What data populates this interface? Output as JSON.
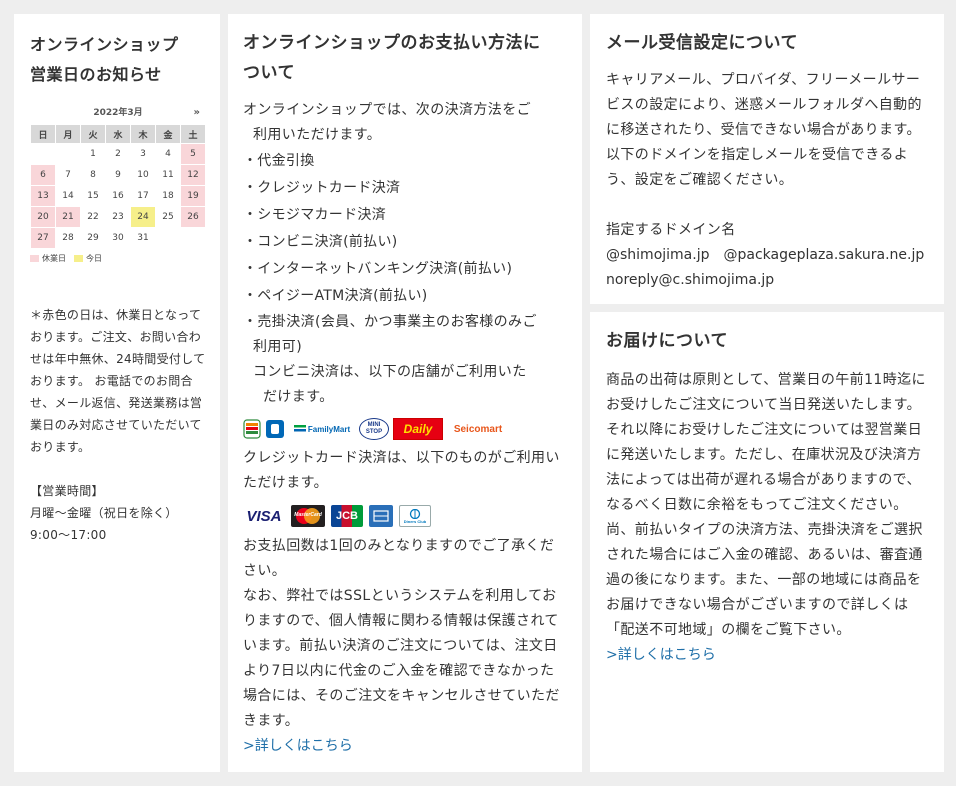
{
  "calendar_box": {
    "title_line1": "オンラインショップ",
    "title_line2": "営業日のお知らせ",
    "month": "2022年3月",
    "next": "»",
    "weekdays": [
      "日",
      "月",
      "火",
      "水",
      "木",
      "金",
      "土"
    ],
    "weeks": [
      [
        "",
        "",
        "1",
        "2",
        "3",
        "4",
        "5"
      ],
      [
        "6",
        "7",
        "8",
        "9",
        "10",
        "11",
        "12"
      ],
      [
        "13",
        "14",
        "15",
        "16",
        "17",
        "18",
        "19"
      ],
      [
        "20",
        "21",
        "22",
        "23",
        "24",
        "25",
        "26"
      ],
      [
        "27",
        "28",
        "29",
        "30",
        "31",
        "",
        ""
      ]
    ],
    "holidays": [
      "5",
      "6",
      "12",
      "13",
      "19",
      "20",
      "21",
      "26",
      "27"
    ],
    "today": "24",
    "legend_holiday": "休業日",
    "legend_today": "今日",
    "holiday_color": "#f9d6d9",
    "today_color": "#f6ef8a",
    "note": "＊赤色の日は、休業日となっております。ご注文、お問い合わせは年中無休、24時間受付しております。 お電話でのお問合せ、メール返信、発送業務は営業日のみ対応させていただいております。",
    "hours_heading": "【営業時間】",
    "hours_days": "月曜～金曜（祝日を除く）",
    "hours_time": "9:00～17:00"
  },
  "payment": {
    "title_line1": "オンラインショップのお支払い方法に",
    "title_line2": "ついて",
    "intro_line1": "オンラインショップでは、次の決済方法をご",
    "intro_line2": "利用いただけます。",
    "methods": [
      "・代金引換",
      "・クレジットカード決済",
      "・シモジマカード決済",
      "・コンビニ決済(前払い)",
      "・インターネットバンキング決済(前払い)",
      "・ペイジーATM決済(前払い)"
    ],
    "method_last_line1": "・売掛決済(会員、かつ事業主のお客様のみご",
    "method_last_line2": "利用可)",
    "conv_line1": "コンビニ決済は、以下の店舗がご利用いた",
    "conv_line2": "だけます。",
    "store_logos": [
      "seven-eleven-logo",
      "lawson-logo",
      "familymart-logo",
      "ministop-logo",
      "daily-yamazaki-logo",
      "seicomart-logo"
    ],
    "store_labels": {
      "familymart": "FamilyMart",
      "ministop": "MINI STOP",
      "daily": "Daily",
      "seicomart": "Seicomart"
    },
    "credit_text": "クレジットカード決済は、以下のものがご利用いただけます。",
    "card_labels": {
      "visa": "VISA",
      "mastercard": "MasterCard",
      "jcb": "JCB",
      "diners": "Diners Club"
    },
    "installments": "お支払回数は1回のみとなりますのでご了承ください。",
    "ssl_text": "なお、弊社ではSSLというシステムを利用しておりますので、個人情報に関わる情報は保護されています。前払い決済のご注文については、注文日より7日以内に代金のご入金を確認できなかった場合には、そのご注文をキャンセルさせていただきます。",
    "more_link": ">詳しくはこちら"
  },
  "mail": {
    "title": "メール受信設定について",
    "body": "キャリアメール、プロバイダ、フリーメールサービスの設定により、迷惑メールフォルダへ自動的に移送されたり、受信できない場合があります。以下のドメインを指定しメールを受信できるよう、設定をご確認ください。",
    "domain_heading": "指定するドメイン名",
    "domains_line1": "@shimojima.jp　@packageplaza.sakura.ne.jp",
    "domains_line2": "noreply@c.shimojima.jp"
  },
  "delivery": {
    "title": "お届けについて",
    "body1": "商品の出荷は原則として、営業日の午前11時迄にお受けしたご注文について当日発送いたします。それ以降にお受けしたご注文については翌営業日に発送いたします。ただし、在庫状況及び決済方法によっては出荷が遅れる場合がありますので、なるべく日数に余裕をもってご注文ください。",
    "body2": "尚、前払いタイプの決済方法、売掛決済をご選択された場合にはご入金の確認、あるいは、審査通過の後になります。また、一部の地域には商品をお届けできない場合がございますので詳しくは「配送不可地域」の欄をご覧下さい。",
    "more_link": ">詳しくはこちら"
  },
  "link_color": "#1f6fa8"
}
